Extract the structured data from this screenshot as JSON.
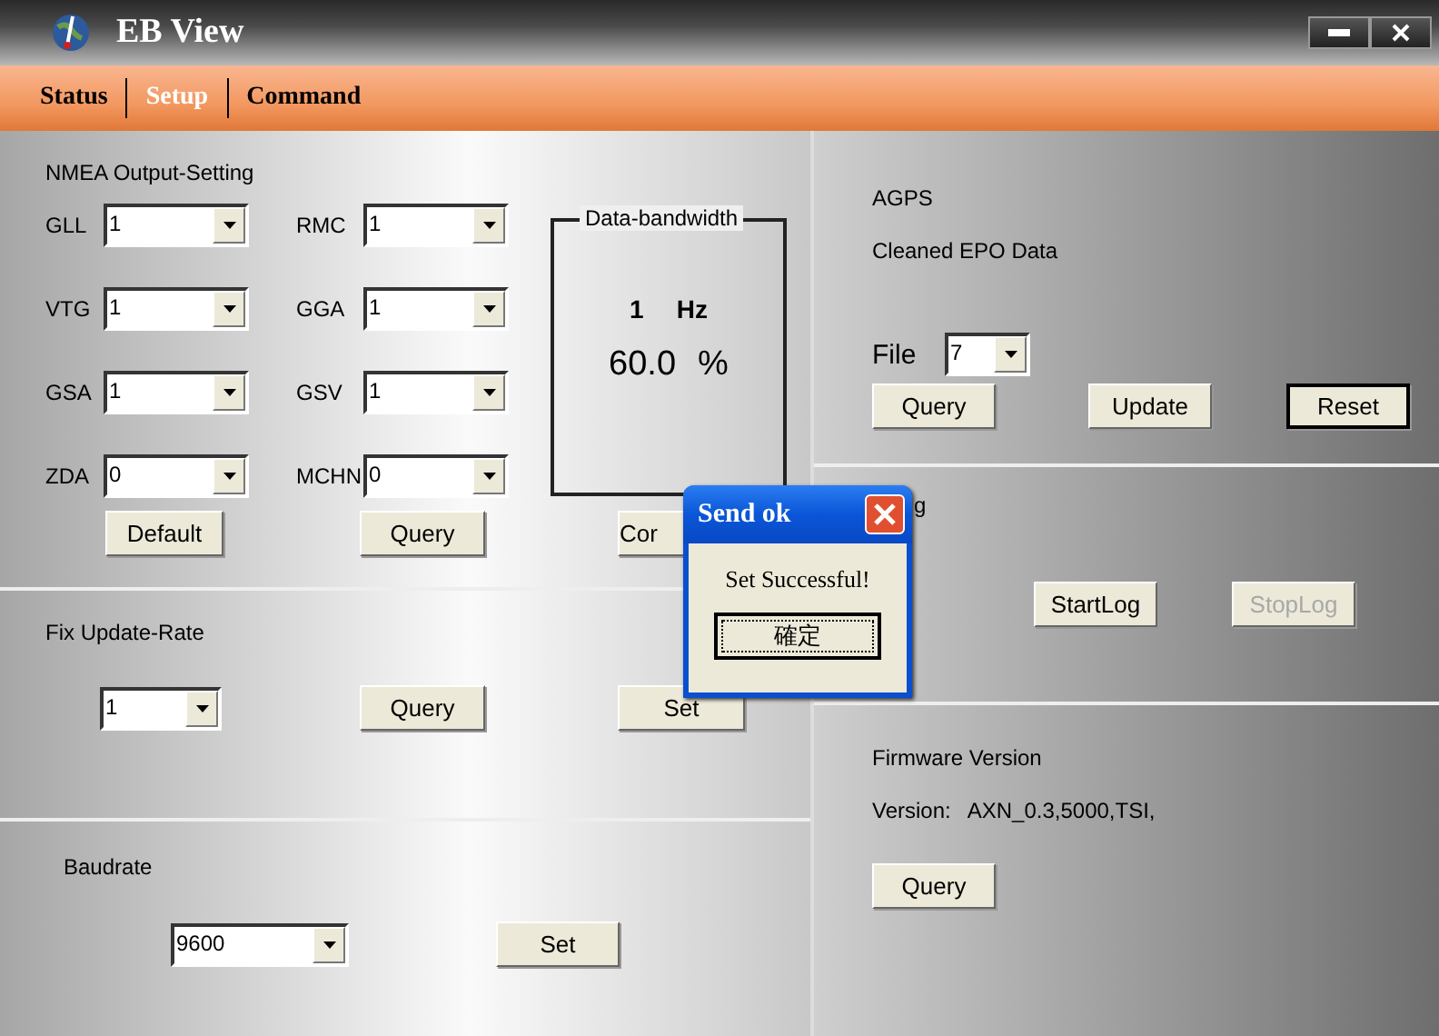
{
  "window": {
    "title": "EB View"
  },
  "tabs": [
    {
      "label": "Status",
      "selected": false
    },
    {
      "label": "Setup",
      "selected": true
    },
    {
      "label": "Command",
      "selected": false
    }
  ],
  "nmea": {
    "title": "NMEA Output-Setting",
    "fields": [
      {
        "label": "GLL",
        "value": "1"
      },
      {
        "label": "RMC",
        "value": "1"
      },
      {
        "label": "VTG",
        "value": "1"
      },
      {
        "label": "GGA",
        "value": "1"
      },
      {
        "label": "GSA",
        "value": "1"
      },
      {
        "label": "GSV",
        "value": "1"
      },
      {
        "label": "ZDA",
        "value": "0"
      },
      {
        "label": "MCHN",
        "value": "0"
      }
    ],
    "bandwidth": {
      "title": "Data-bandwidth",
      "rate": "1",
      "unit": "Hz",
      "percent": "60.0",
      "percent_sign": "%"
    },
    "buttons": [
      {
        "label": "Default"
      },
      {
        "label": "Query"
      },
      {
        "label": "Cor"
      }
    ]
  },
  "fix_update_rate": {
    "title": "Fix Update-Rate",
    "value": "1",
    "buttons": [
      {
        "label": "Query"
      },
      {
        "label": "Set"
      }
    ]
  },
  "baudrate": {
    "title": "Baudrate",
    "value": "9600",
    "buttons": [
      {
        "label": "Set"
      }
    ]
  },
  "agps": {
    "title": "AGPS",
    "status": "Cleaned EPO Data",
    "file_label": "File",
    "file_value": "7",
    "buttons": [
      {
        "label": "Query",
        "default": false
      },
      {
        "label": "Update",
        "default": false
      },
      {
        "label": "Reset",
        "default": true
      }
    ]
  },
  "log": {
    "title": "g",
    "buttons": [
      {
        "label": "StartLog",
        "disabled": false
      },
      {
        "label": "StopLog",
        "disabled": true
      }
    ]
  },
  "firmware": {
    "title": "Firmware Version",
    "version_label": "Version:",
    "version": "AXN_0.3,5000,TSI,",
    "buttons": [
      {
        "label": "Query"
      }
    ]
  },
  "dialog": {
    "title": "Send ok",
    "message": "Set Successful!",
    "button": "確定"
  }
}
